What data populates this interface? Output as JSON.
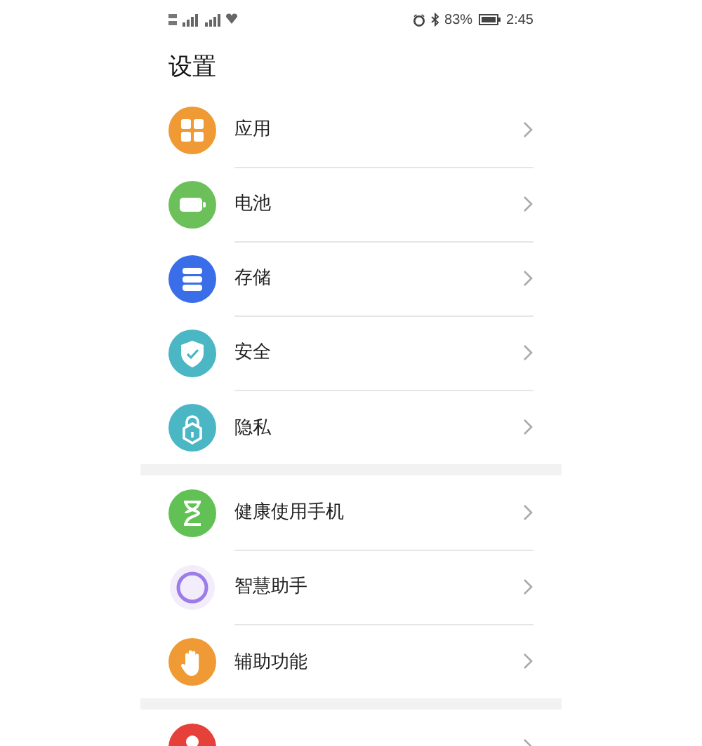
{
  "status_bar": {
    "battery_percent": "83%",
    "time": "2:45"
  },
  "title": "设置",
  "groups": [
    {
      "items": [
        {
          "label": "应用",
          "kind": "grid",
          "color": "#ef9a34"
        },
        {
          "label": "电池",
          "kind": "battery",
          "color": "#6cc05a"
        },
        {
          "label": "存储",
          "kind": "storage",
          "color": "#3a6ee8"
        },
        {
          "label": "安全",
          "kind": "shield",
          "color": "#4bb6c4"
        },
        {
          "label": "隐私",
          "kind": "lock",
          "color": "#4bb6c4"
        }
      ]
    },
    {
      "items": [
        {
          "label": "健康使用手机",
          "kind": "hourglass",
          "color": "#62c154"
        },
        {
          "label": "智慧助手",
          "kind": "ring",
          "color": "#9b7ce8"
        },
        {
          "label": "辅助功能",
          "kind": "hand",
          "color": "#ef9a34"
        }
      ]
    },
    {
      "items": [
        {
          "kind": "user",
          "color": "#e5403a"
        }
      ]
    }
  ]
}
